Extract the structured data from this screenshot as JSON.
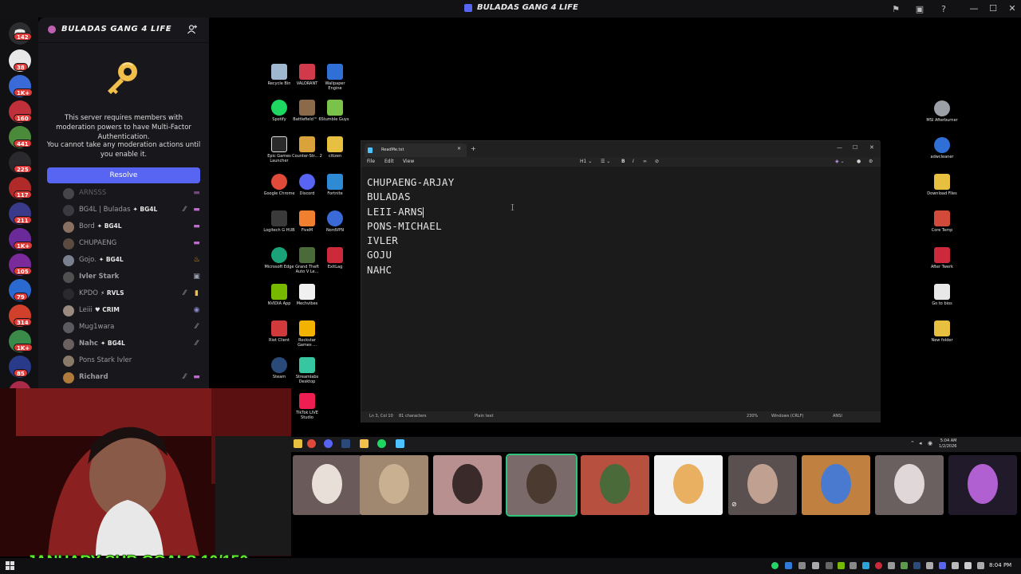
{
  "window": {
    "title": "BULADAS GANG 4 LIFE"
  },
  "rail": {
    "badges": [
      "142",
      "38",
      "1K+",
      "160",
      "441",
      "225",
      "117",
      "211",
      "1K+",
      "105",
      "79",
      "314",
      "1K+",
      "85"
    ]
  },
  "server": {
    "name": "BULADAS GANG 4 LIFE",
    "mfa_notice_1": "This server requires members with moderation powers to have Multi-Factor Authentication.",
    "mfa_notice_2": "You cannot take any moderation actions until you enable it.",
    "resolve_label": "Resolve"
  },
  "members": [
    {
      "name": "ARNSSS",
      "tag": "",
      "bold": false
    },
    {
      "name": "BG4L | Buladas",
      "tag": "BG4L",
      "bold": false
    },
    {
      "name": "Bord",
      "tag": "BG4L",
      "bold": false
    },
    {
      "name": "CHUPAENG",
      "tag": "",
      "bold": false
    },
    {
      "name": "Gojo.",
      "tag": "BG4L",
      "bold": false
    },
    {
      "name": "Ivler Stark",
      "tag": "",
      "bold": true
    },
    {
      "name": "KPDO",
      "tag": "RVLS",
      "bold": false
    },
    {
      "name": "Leiii",
      "tag": "CRIM",
      "bold": false
    },
    {
      "name": "Mug1wara",
      "tag": "",
      "bold": false
    },
    {
      "name": "Nahc",
      "tag": "BG4L",
      "bold": true
    },
    {
      "name": "Pons Stark Ivler",
      "tag": "",
      "bold": false
    },
    {
      "name": "Richard",
      "tag": "",
      "bold": true
    }
  ],
  "desktop_icons": [
    {
      "label": "Recycle Bin",
      "color": "#9fb8d0"
    },
    {
      "label": "VALORANT",
      "color": "#d13a4a"
    },
    {
      "label": "Wallpaper Engine",
      "color": "#2f6fd6"
    },
    {
      "label": "Spotify",
      "color": "#1ed760"
    },
    {
      "label": "Battlefield™ 6",
      "color": "#8a6a4a"
    },
    {
      "label": "Stumble Guys",
      "color": "#7bc24a"
    },
    {
      "label": "Epic Games Launcher",
      "color": "#2a2a2a"
    },
    {
      "label": "Counter-Str... 2",
      "color": "#d9a23a"
    },
    {
      "label": "citizen",
      "color": "#e8c040"
    },
    {
      "label": "Google Chrome",
      "color": "#e04a3a"
    },
    {
      "label": "Discord",
      "color": "#5865f2"
    },
    {
      "label": "Fortnite",
      "color": "#2f8ad6"
    },
    {
      "label": "Logitech G HUB",
      "color": "#3a3a3a"
    },
    {
      "label": "FiveM",
      "color": "#f08030"
    },
    {
      "label": "NordVPN",
      "color": "#3a6ad8"
    },
    {
      "label": "Microsoft Edge",
      "color": "#1aa37a"
    },
    {
      "label": "Grand Theft Auto V Le...",
      "color": "#4a6a3a"
    },
    {
      "label": "ExitLag",
      "color": "#cc2a3a"
    },
    {
      "label": "NVIDIA App",
      "color": "#76b900"
    },
    {
      "label": "Mechvibes",
      "color": "#f0f0f0"
    },
    {
      "label": "Riot Client",
      "color": "#d13a3a"
    },
    {
      "label": "Rockstar Games ...",
      "color": "#f2b300"
    },
    {
      "label": "Steam",
      "color": "#2a4a7a"
    },
    {
      "label": "Streamlabs Desktop",
      "color": "#36c7a0"
    },
    {
      "label": "TikTok LIVE Studio",
      "color": "#ee1d52"
    }
  ],
  "right_icons": [
    {
      "label": "MSI Afterburner",
      "color": "#9aa0a6"
    },
    {
      "label": "adwcleaner",
      "color": "#2f6fd6"
    },
    {
      "label": "Download Files",
      "color": "#e8c040"
    },
    {
      "label": "Core Temp",
      "color": "#d14a3a"
    },
    {
      "label": "After Twerk",
      "color": "#cc2a3a"
    },
    {
      "label": "Go to bios",
      "color": "#e8e8e8"
    },
    {
      "label": "New folder",
      "color": "#e8c040"
    }
  ],
  "notepad": {
    "tab_name": "ReadMe.txt",
    "menus": [
      "File",
      "Edit",
      "View"
    ],
    "heading_control": "H1",
    "lines": [
      "CHUPAENG-ARJAY",
      "BULADAS",
      "LEII-ARNS",
      "PONS-MICHAEL",
      "IVLER",
      "GOJU",
      "NAHC"
    ],
    "status": {
      "position": "Ln 3, Col 10",
      "chars": "81 characters",
      "format": "Plain text",
      "zoom": "230%",
      "line_ending": "Windows (CRLF)",
      "encoding": "ANSI"
    }
  },
  "mini_taskbar": {
    "time": "5:04 AM",
    "date": "1/2/2026"
  },
  "participants": {
    "count": 10,
    "speaking_index": 3,
    "muted_index": 6
  },
  "overlay": {
    "goal_text": "JANUARY SUB GOALS 10/150"
  },
  "taskbar": {
    "time": "8:04 PM"
  }
}
